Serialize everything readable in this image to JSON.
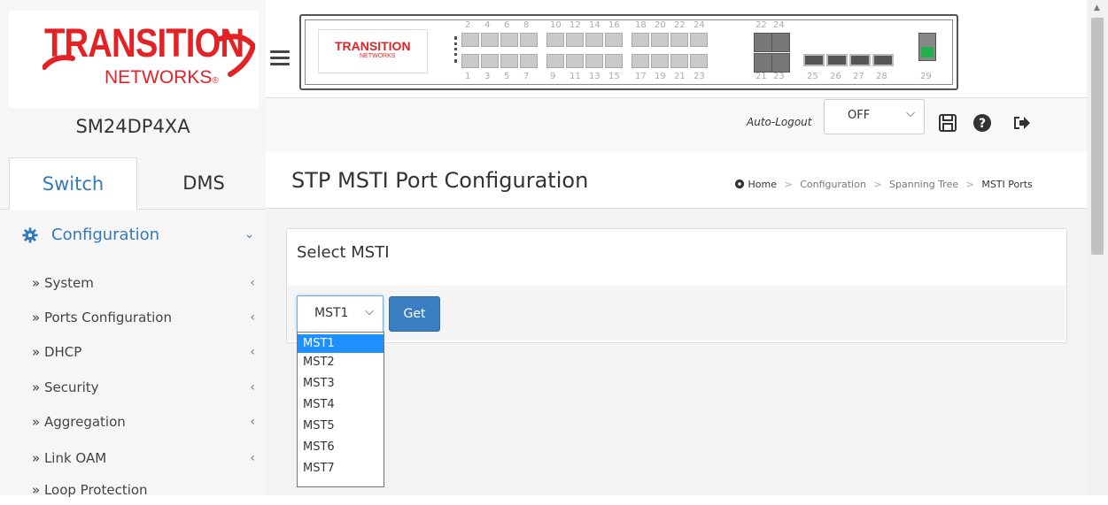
{
  "brand": {
    "logo_main": "TRANSITION",
    "logo_sub": "NETWORKS",
    "logo_mark": "®",
    "model": "SM24DP4XA"
  },
  "sidebar": {
    "tabs": [
      {
        "label": "Switch",
        "active": true
      },
      {
        "label": "DMS",
        "active": false
      }
    ],
    "section": {
      "label": "Configuration",
      "icon": "gear-icon",
      "expanded": true
    },
    "items": [
      {
        "label": "» System"
      },
      {
        "label": "» Ports Configuration"
      },
      {
        "label": "» DHCP"
      },
      {
        "label": "» Security"
      },
      {
        "label": "» Aggregation"
      },
      {
        "label": "» Link OAM"
      },
      {
        "label": "» Loop Protection"
      }
    ]
  },
  "switch_panel": {
    "top_numbers": [
      "2",
      "4",
      "6",
      "8",
      "10",
      "12",
      "14",
      "16",
      "18",
      "20",
      "22",
      "24",
      "22",
      "24"
    ],
    "bottom_numbers": [
      "1",
      "3",
      "5",
      "7",
      "9",
      "11",
      "13",
      "15",
      "17",
      "19",
      "21",
      "23",
      "21",
      "23",
      "25",
      "26",
      "27",
      "28",
      "29"
    ]
  },
  "header": {
    "auto_logout_label": "Auto-Logout",
    "auto_logout_value": "OFF",
    "icons": [
      "save-icon",
      "help-icon",
      "logout-icon"
    ]
  },
  "page": {
    "title": "STP MSTI Port Configuration",
    "breadcrumb": [
      "Home",
      "Configuration",
      "Spanning Tree",
      "MSTI Ports"
    ],
    "breadcrumb_separator": ">"
  },
  "panel": {
    "title": "Select MSTI",
    "select_value": "MST1",
    "get_label": "Get",
    "options": [
      "MST1",
      "MST2",
      "MST3",
      "MST4",
      "MST5",
      "MST6",
      "MST7"
    ],
    "selected_option": "MST1"
  },
  "colors": {
    "brand_red": "#e32226",
    "accent_blue": "#337ab7",
    "button_blue": "#3a7fc1",
    "option_highlight": "#1e90ff",
    "port_green": "#22b14c"
  }
}
